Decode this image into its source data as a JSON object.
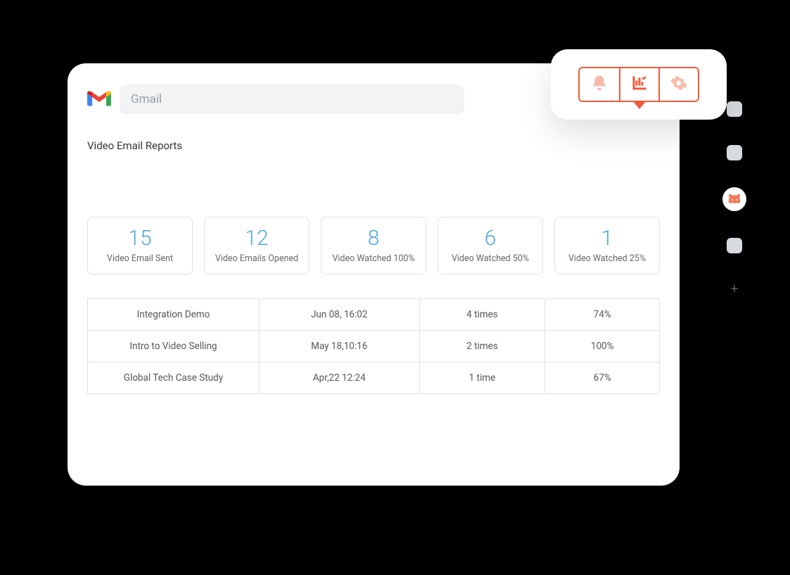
{
  "header": {
    "search_placeholder": "Gmail"
  },
  "page": {
    "title": "Video Email Reports"
  },
  "stats": [
    {
      "value": "15",
      "label": "Video Email Sent"
    },
    {
      "value": "12",
      "label": "Video Emails Opened"
    },
    {
      "value": "8",
      "label": "Video Watched 100%"
    },
    {
      "value": "6",
      "label": "Video Watched 50%"
    },
    {
      "value": "1",
      "label": "Video Watched 25%"
    }
  ],
  "table": {
    "rows": [
      {
        "title": "Integration Demo",
        "date": "Jun 08, 16:02",
        "views": "4 times",
        "pct": "74%"
      },
      {
        "title": "Intro to Video Selling",
        "date": "May 18,10:16",
        "views": "2 times",
        "pct": "100%"
      },
      {
        "title": "Global Tech Case Study",
        "date": "Apr,22 12:24",
        "views": "1 time",
        "pct": "67%"
      }
    ]
  },
  "toolbar": {
    "items": [
      "notifications",
      "analytics",
      "settings"
    ],
    "active_index": 1
  },
  "rail": {
    "plus": "+"
  }
}
